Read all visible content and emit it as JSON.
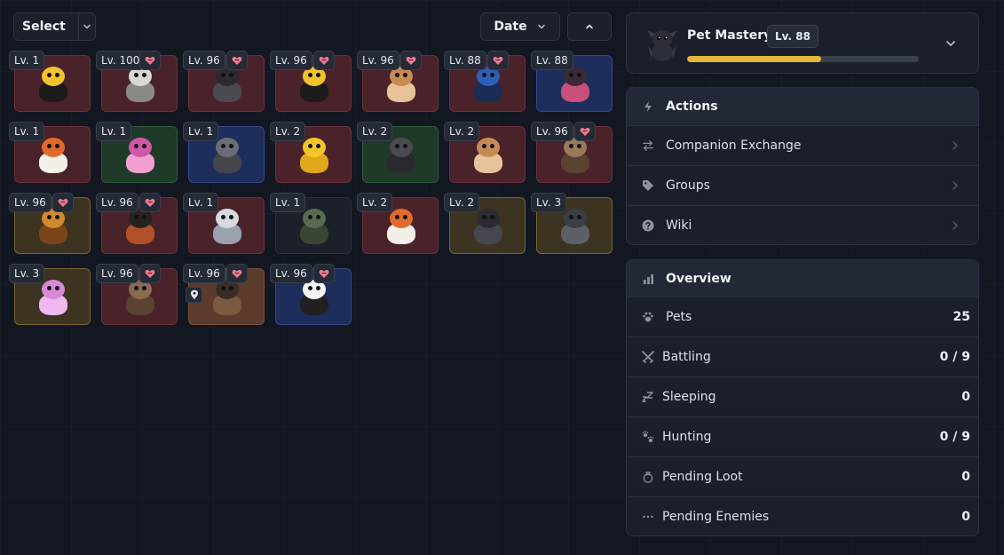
{
  "toolbar": {
    "select_label": "Select",
    "sort_label": "Date"
  },
  "pets": [
    {
      "level": "Lv. 1",
      "favorite": false,
      "bg": "red",
      "color": "#f2c12e",
      "accent": "#1b1b1b",
      "creature": "bee"
    },
    {
      "level": "Lv. 100",
      "favorite": true,
      "bg": "red",
      "color": "#d9d9d4",
      "accent": "#8a8a86",
      "creature": "skeleton"
    },
    {
      "level": "Lv. 96",
      "favorite": true,
      "bg": "red",
      "color": "#2a2a30",
      "accent": "#4a4a52",
      "creature": "cat"
    },
    {
      "level": "Lv. 96",
      "favorite": true,
      "bg": "red",
      "color": "#f2c12e",
      "accent": "#1b1b1b",
      "creature": "bee"
    },
    {
      "level": "Lv. 96",
      "favorite": true,
      "bg": "red",
      "color": "#c88a55",
      "accent": "#e8c39a",
      "creature": "rabbit"
    },
    {
      "level": "Lv. 88",
      "favorite": true,
      "bg": "red",
      "color": "#2c5fb8",
      "accent": "#1a2c55",
      "creature": "wolf"
    },
    {
      "level": "Lv. 88",
      "favorite": false,
      "bg": "blue",
      "color": "#3a2a36",
      "accent": "#c8507a",
      "creature": "boar"
    },
    {
      "level": "Lv. 1",
      "favorite": false,
      "bg": "red",
      "color": "#e06a2a",
      "accent": "#f3f0ea",
      "creature": "fox"
    },
    {
      "level": "Lv. 1",
      "favorite": false,
      "bg": "green",
      "color": "#d158a8",
      "accent": "#f0a0d0",
      "creature": "dragon"
    },
    {
      "level": "Lv. 1",
      "favorite": false,
      "bg": "blue",
      "color": "#6c6c74",
      "accent": "#45454c",
      "creature": "horse"
    },
    {
      "level": "Lv. 2",
      "favorite": false,
      "bg": "red",
      "color": "#f2c62a",
      "accent": "#e0a818",
      "creature": "chick"
    },
    {
      "level": "Lv. 2",
      "favorite": false,
      "bg": "green",
      "color": "#4a4a50",
      "accent": "#2a2a2e",
      "creature": "dog"
    },
    {
      "level": "Lv. 2",
      "favorite": false,
      "bg": "red",
      "color": "#c88a55",
      "accent": "#e8c39a",
      "creature": "rabbit"
    },
    {
      "level": "Lv. 96",
      "favorite": true,
      "bg": "red",
      "color": "#9a7a5c",
      "accent": "#5a4330",
      "creature": "deer"
    },
    {
      "level": "Lv. 96",
      "favorite": true,
      "bg": "gold",
      "color": "#d08a2e",
      "accent": "#7a4418",
      "creature": "lion"
    },
    {
      "level": "Lv. 96",
      "favorite": true,
      "bg": "red",
      "color": "#26221f",
      "accent": "#b05028",
      "creature": "raven"
    },
    {
      "level": "Lv. 1",
      "favorite": false,
      "bg": "red",
      "color": "#d6dae0",
      "accent": "#9aa2ae",
      "creature": "unicorn"
    },
    {
      "level": "Lv. 1",
      "favorite": false,
      "bg": "dark",
      "color": "#5a6a4e",
      "accent": "#3a4632",
      "creature": "turtle"
    },
    {
      "level": "Lv. 2",
      "favorite": false,
      "bg": "red",
      "color": "#e06a2a",
      "accent": "#f3f0ea",
      "creature": "fox"
    },
    {
      "level": "Lv. 2",
      "favorite": false,
      "bg": "gold",
      "color": "#2a2c34",
      "accent": "#44474f",
      "creature": "dragon"
    },
    {
      "level": "Lv. 3",
      "favorite": false,
      "bg": "gold",
      "color": "#3c3e46",
      "accent": "#5c5e68",
      "creature": "dragon"
    },
    {
      "level": "Lv. 3",
      "favorite": false,
      "bg": "gold",
      "color": "#d68ad6",
      "accent": "#f0b8f0",
      "creature": "dragon"
    },
    {
      "level": "Lv. 96",
      "favorite": true,
      "bg": "red",
      "color": "#8a6a50",
      "accent": "#5a4330",
      "creature": "deer"
    },
    {
      "level": "Lv. 96",
      "favorite": true,
      "bg": "brown",
      "color": "#3a2c24",
      "accent": "#7a5a40",
      "creature": "bull",
      "pinned": true
    },
    {
      "level": "Lv. 96",
      "favorite": true,
      "bg": "blue",
      "color": "#f4f4f4",
      "accent": "#202020",
      "creature": "jellyfish"
    }
  ],
  "mastery": {
    "title": "Pet Mastery",
    "level": "Lv. 88",
    "progress": 0.58
  },
  "actions": {
    "header": "Actions",
    "items": [
      {
        "label": "Companion Exchange",
        "icon": "swap-icon"
      },
      {
        "label": "Groups",
        "icon": "tag-icon"
      },
      {
        "label": "Wiki",
        "icon": "help-icon"
      }
    ]
  },
  "overview": {
    "header": "Overview",
    "rows": [
      {
        "label": "Pets",
        "value": "25",
        "icon": "paw-icon"
      },
      {
        "label": "Battling",
        "value": "0 / 9",
        "icon": "swords-icon"
      },
      {
        "label": "Sleeping",
        "value": "0",
        "icon": "sleep-icon"
      },
      {
        "label": "Hunting",
        "value": "0 / 9",
        "icon": "paws-icon"
      },
      {
        "label": "Pending Loot",
        "value": "0",
        "icon": "pouch-icon"
      },
      {
        "label": "Pending Enemies",
        "value": "0",
        "icon": "ellipsis-icon"
      }
    ]
  },
  "colors": {
    "accent_gold": "#e5b63a",
    "heart": "#f07a8a",
    "background": "#131722"
  }
}
